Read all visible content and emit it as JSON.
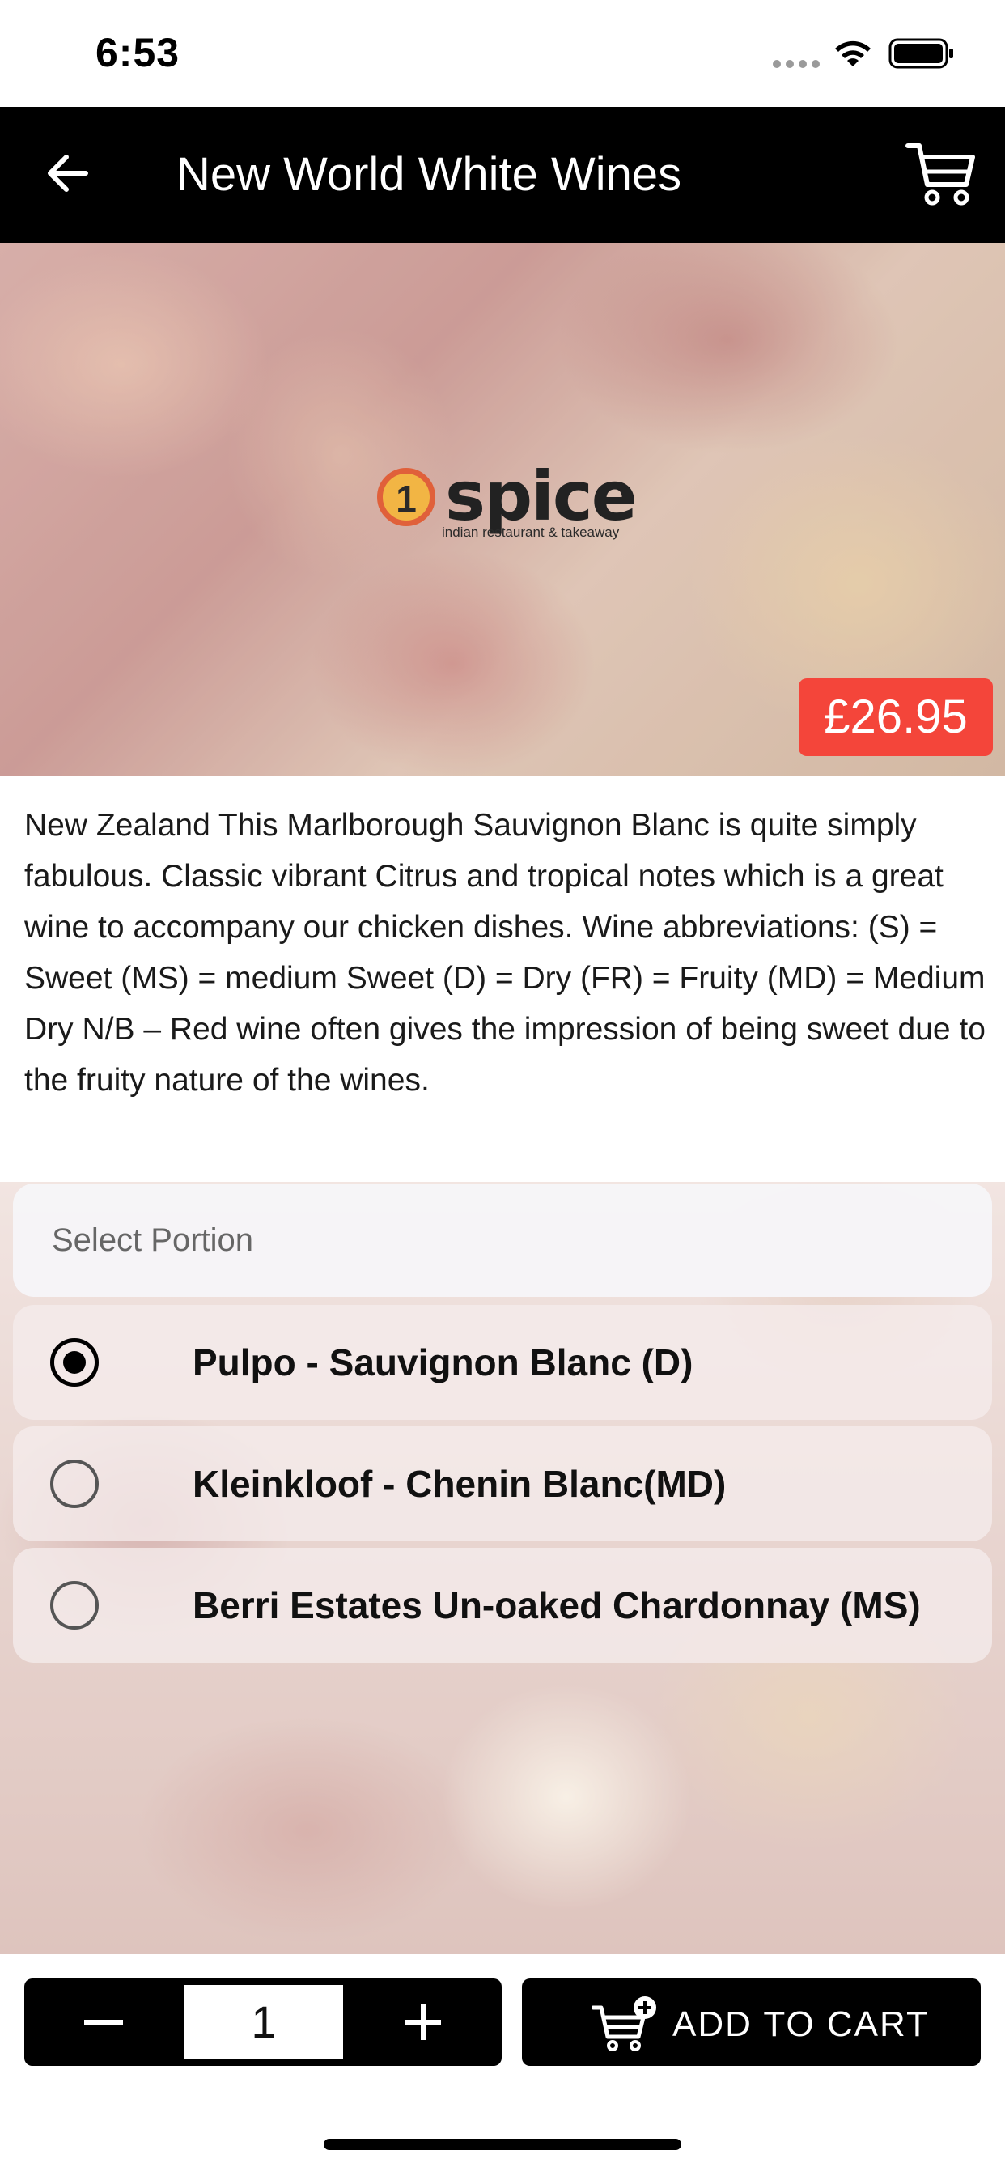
{
  "status_bar": {
    "time": "6:53",
    "icons": [
      "signal-icon",
      "wifi-icon",
      "battery-icon"
    ]
  },
  "nav": {
    "title": "New World White Wines",
    "back_icon": "back-arrow-icon",
    "cart_icon": "cart-icon"
  },
  "hero": {
    "logo_mark": "1",
    "logo_text": "spice",
    "logo_tagline": "indian restaurant & takeaway",
    "price": "£26.95",
    "price_color": "#f4453a"
  },
  "description": "New Zealand This Marlborough Sauvignon Blanc is quite simply fabulous. Classic vibrant Citrus and tropical notes which is a great wine to accompany our chicken dishes. Wine abbreviations: (S) = Sweet (MS) = medium Sweet (D) = Dry (FR) = Fruity (MD) = Medium Dry N/B – Red wine often gives the impression of being sweet due to the fruity nature of the wines.",
  "portion": {
    "header": "Select Portion",
    "options": [
      {
        "label": "Pulpo - Sauvignon Blanc (D)",
        "selected": true
      },
      {
        "label": "Kleinkloof - Chenin Blanc(MD)",
        "selected": false
      },
      {
        "label": "Berri Estates Un-oaked Chardonnay (MS)",
        "selected": false
      }
    ]
  },
  "bottom": {
    "quantity": "1",
    "minus_icon": "minus-icon",
    "plus_icon": "plus-icon",
    "add_to_cart_label": "ADD TO CART",
    "add_to_cart_icon": "cart-add-icon"
  }
}
